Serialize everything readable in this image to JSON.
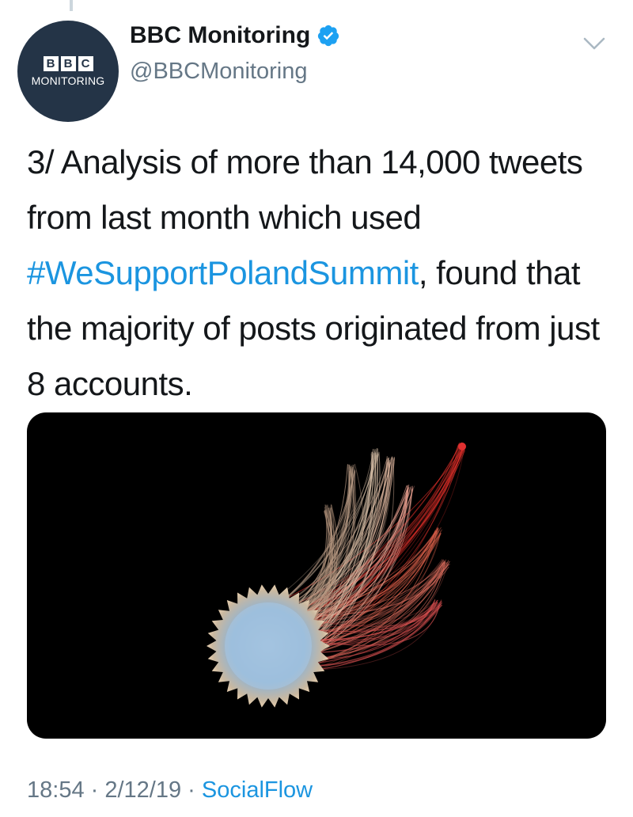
{
  "tweet": {
    "author": {
      "display_name": "BBC Monitoring",
      "handle": "@BBCMonitoring",
      "verified": true,
      "avatar": {
        "logo_letters": [
          "B",
          "B",
          "C"
        ],
        "subtitle": "MONITORING",
        "background_color": "#243447"
      }
    },
    "text": {
      "part1": "3/ Analysis of more than 14,000 tweets from last month which used ",
      "hashtag": "#WeSupportPolandSummit",
      "part2": ", found that the majority of posts originated from just 8 accounts."
    },
    "media": {
      "description_icon": "network-visualization-image"
    },
    "meta": {
      "time": "18:54",
      "separator": " · ",
      "date": "2/12/19",
      "source": "SocialFlow"
    }
  },
  "colors": {
    "link": "#1b95e0",
    "text": "#14171a",
    "secondary": "#657786",
    "verified": "#1da1f2"
  }
}
